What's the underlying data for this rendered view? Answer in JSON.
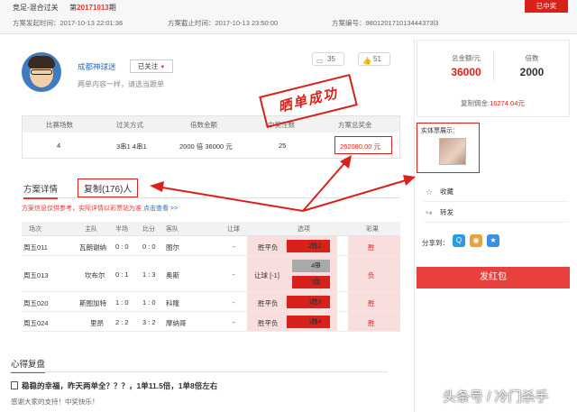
{
  "header": {
    "title_prefix": "竞足-混合过关",
    "title_issue_label": "第",
    "title_issue": "20171013",
    "title_issue_suffix": "期",
    "post_time": "方案发起时间：2017-10-13 22:01:36",
    "close_time": "方案截止时间：2017-10-13 23:50:00",
    "plan_no": "方案编号：980120171013444373l3",
    "status_badge": "已中奖"
  },
  "user": {
    "name": "成都神球迷",
    "follow_label": "已关注",
    "description": "两单内容一样，请选当跟单",
    "comments_count": "35",
    "likes_count": "51"
  },
  "summary": {
    "headers": [
      "比赛场数",
      "过关方式",
      "倍数金额",
      "中奖注数",
      "方案总奖金"
    ],
    "values": [
      "4",
      "3串1 4串1",
      "2000 倍  36000 元",
      "25",
      "262080.00 元"
    ]
  },
  "stamp": {
    "text": "晒单成功"
  },
  "tabs": {
    "detail": "方案详情",
    "copy": "复制(176)人"
  },
  "notice": {
    "text": "方案信息仅供参考，实际详情以彩票站为准",
    "link": "点击查看 >>"
  },
  "match_table": {
    "headers": [
      "场次",
      "主队",
      "半场",
      "比分",
      "客队",
      "让球",
      "选项",
      "彩果"
    ],
    "rows": [
      {
        "no": "周五011",
        "home": "瓦朗谢纳",
        "half": "0 : 0",
        "score": "0 : 0",
        "away": "图尔",
        "handicap": "-",
        "play": "胜平负",
        "picks": [
          {
            "o": "胜",
            "v": "2.12",
            "hit": true
          }
        ],
        "result": "胜"
      },
      {
        "no": "周五013",
        "home": "坎布尔",
        "half": "0 : 1",
        "score": "1 : 3",
        "away": "奥斯",
        "handicap": "-",
        "play": "让球 [-1]",
        "picks": [
          {
            "o": "平",
            "v": "4.0",
            "hit": false
          },
          {
            "o": "负",
            "v": "3.2",
            "hit": true
          }
        ],
        "result": "负"
      },
      {
        "no": "周五020",
        "home": "斯图加特",
        "half": "1 : 0",
        "score": "1 : 0",
        "away": "科隆",
        "handicap": "-",
        "play": "胜平负",
        "picks": [
          {
            "o": "胜",
            "v": "1.73",
            "hit": true
          }
        ],
        "result": "胜"
      },
      {
        "no": "周五024",
        "home": "里昂",
        "half": "2 : 2",
        "score": "3 : 2",
        "away": "摩纳哥",
        "handicap": "-",
        "play": "胜平负",
        "picks": [
          {
            "o": "胜",
            "v": "1.94",
            "hit": true
          }
        ],
        "result": "胜"
      }
    ]
  },
  "review": {
    "title": "心得复盘",
    "headline": "稳稳的幸福，昨天两单全？？？，1单11.5倍，1单8倍左右",
    "body": "感谢大家的支持！中奖快乐！"
  },
  "side": {
    "total_label": "总金额/元",
    "total_value": "36000",
    "multiple_label": "倍数",
    "multiple_value": "2000",
    "commission_label": "复制佣金:",
    "commission_value": "16274.04元",
    "ticket_label": "实体票展示：",
    "collect_label": "收藏",
    "repost_label": "转发",
    "share_label": "分享到：",
    "redpack_label": "发红包"
  },
  "watermark": "头条号 / 冷门杀手",
  "colors": {
    "accent": "#d9211b",
    "link": "#2a6fc2",
    "highlight_bg": "#f9dede"
  }
}
